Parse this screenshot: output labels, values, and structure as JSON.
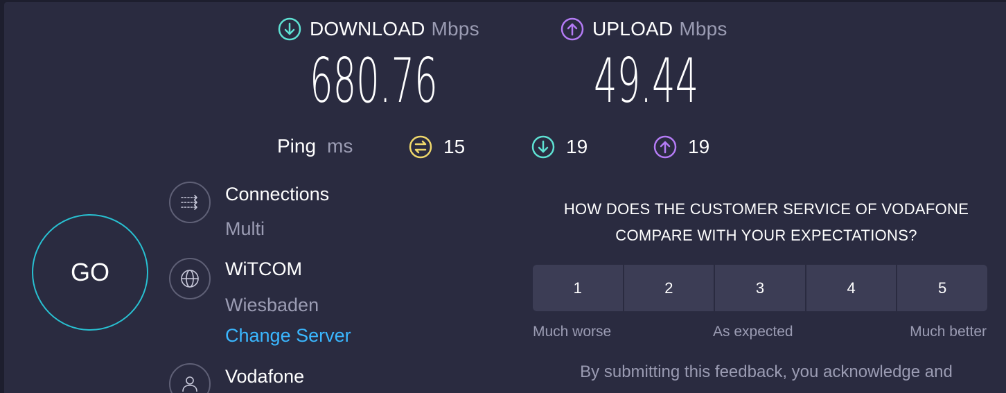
{
  "results": {
    "download": {
      "label": "DOWNLOAD",
      "unit": "Mbps",
      "value": "680.76",
      "icon": "download-arrow-icon",
      "color": "#5ee1d3"
    },
    "upload": {
      "label": "UPLOAD",
      "unit": "Mbps",
      "value": "49.44",
      "icon": "upload-arrow-icon",
      "color": "#b47bf5"
    }
  },
  "ping": {
    "label": "Ping",
    "unit": "ms",
    "idle": {
      "value": "15",
      "icon": "ping-idle-icon",
      "color": "#f0d86b"
    },
    "download": {
      "value": "19",
      "icon": "ping-download-icon",
      "color": "#5ee1d3"
    },
    "upload": {
      "value": "19",
      "icon": "ping-upload-icon",
      "color": "#b47bf5"
    }
  },
  "go_button": {
    "label": "GO",
    "color": "#28c1d2"
  },
  "connections": {
    "title": "Connections",
    "value": "Multi",
    "icon": "connections-icon"
  },
  "server": {
    "title": "WiTCOM",
    "location": "Wiesbaden",
    "change_link": "Change Server",
    "icon": "globe-icon"
  },
  "provider": {
    "title": "Vodafone",
    "icon": "user-icon"
  },
  "survey": {
    "question_line1": "HOW DOES THE CUSTOMER SERVICE OF VODAFONE",
    "question_line2": "COMPARE WITH YOUR EXPECTATIONS?",
    "ratings": [
      "1",
      "2",
      "3",
      "4",
      "5"
    ],
    "scale_low": "Much worse",
    "scale_mid": "As expected",
    "scale_high": "Much better",
    "disclaimer": "By submitting this feedback, you acknowledge and"
  },
  "colors": {
    "background": "#2a2b40",
    "muted_text": "#9b9cb3",
    "link": "#3ab7ff",
    "rating_button": "#3c3d55"
  }
}
